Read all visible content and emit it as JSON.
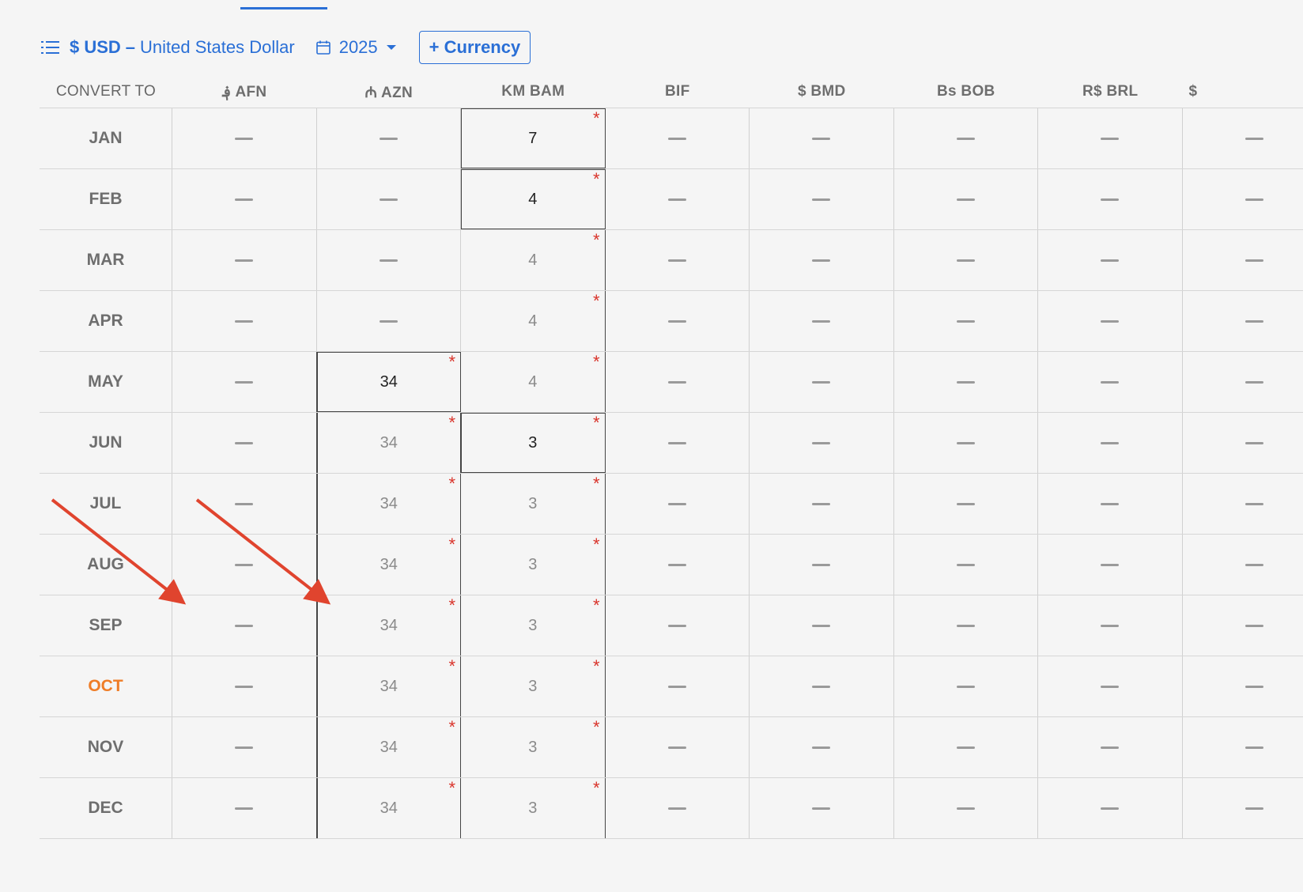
{
  "toolbar": {
    "base_currency_code": "$ USD",
    "base_currency_separator": "–",
    "base_currency_name": "United States Dollar",
    "year": "2025",
    "add_currency_label": "+ Currency"
  },
  "grid": {
    "first_header": "CONVERT TO",
    "columns": [
      "؋ AFN",
      "₼ AZN",
      "KM BAM",
      "BIF",
      "$ BMD",
      "Bs BOB",
      "R$ BRL",
      "$"
    ],
    "current_month": "OCT",
    "rows": [
      {
        "month": "JAN",
        "AFN": "",
        "AZN": "",
        "BAM": "7"
      },
      {
        "month": "FEB",
        "AFN": "",
        "AZN": "",
        "BAM": "4"
      },
      {
        "month": "MAR",
        "AFN": "",
        "AZN": "",
        "BAM": "4"
      },
      {
        "month": "APR",
        "AFN": "",
        "AZN": "",
        "BAM": "4"
      },
      {
        "month": "MAY",
        "AFN": "",
        "AZN": "34",
        "BAM": "4"
      },
      {
        "month": "JUN",
        "AFN": "",
        "AZN": "34",
        "BAM": "3"
      },
      {
        "month": "JUL",
        "AFN": "",
        "AZN": "34",
        "BAM": "3"
      },
      {
        "month": "AUG",
        "AFN": "",
        "AZN": "34",
        "BAM": "3"
      },
      {
        "month": "SEP",
        "AFN": "",
        "AZN": "34",
        "BAM": "3"
      },
      {
        "month": "OCT",
        "AFN": "",
        "AZN": "34",
        "BAM": "3"
      },
      {
        "month": "NOV",
        "AFN": "",
        "AZN": "34",
        "BAM": "3"
      },
      {
        "month": "DEC",
        "AFN": "",
        "AZN": "34",
        "BAM": "3"
      }
    ],
    "required_marker": "*"
  },
  "colors": {
    "accent": "#2a6fd6",
    "current_month": "#ef7d27",
    "required": "#d9342b",
    "annotation_arrow": "#e0442e"
  }
}
